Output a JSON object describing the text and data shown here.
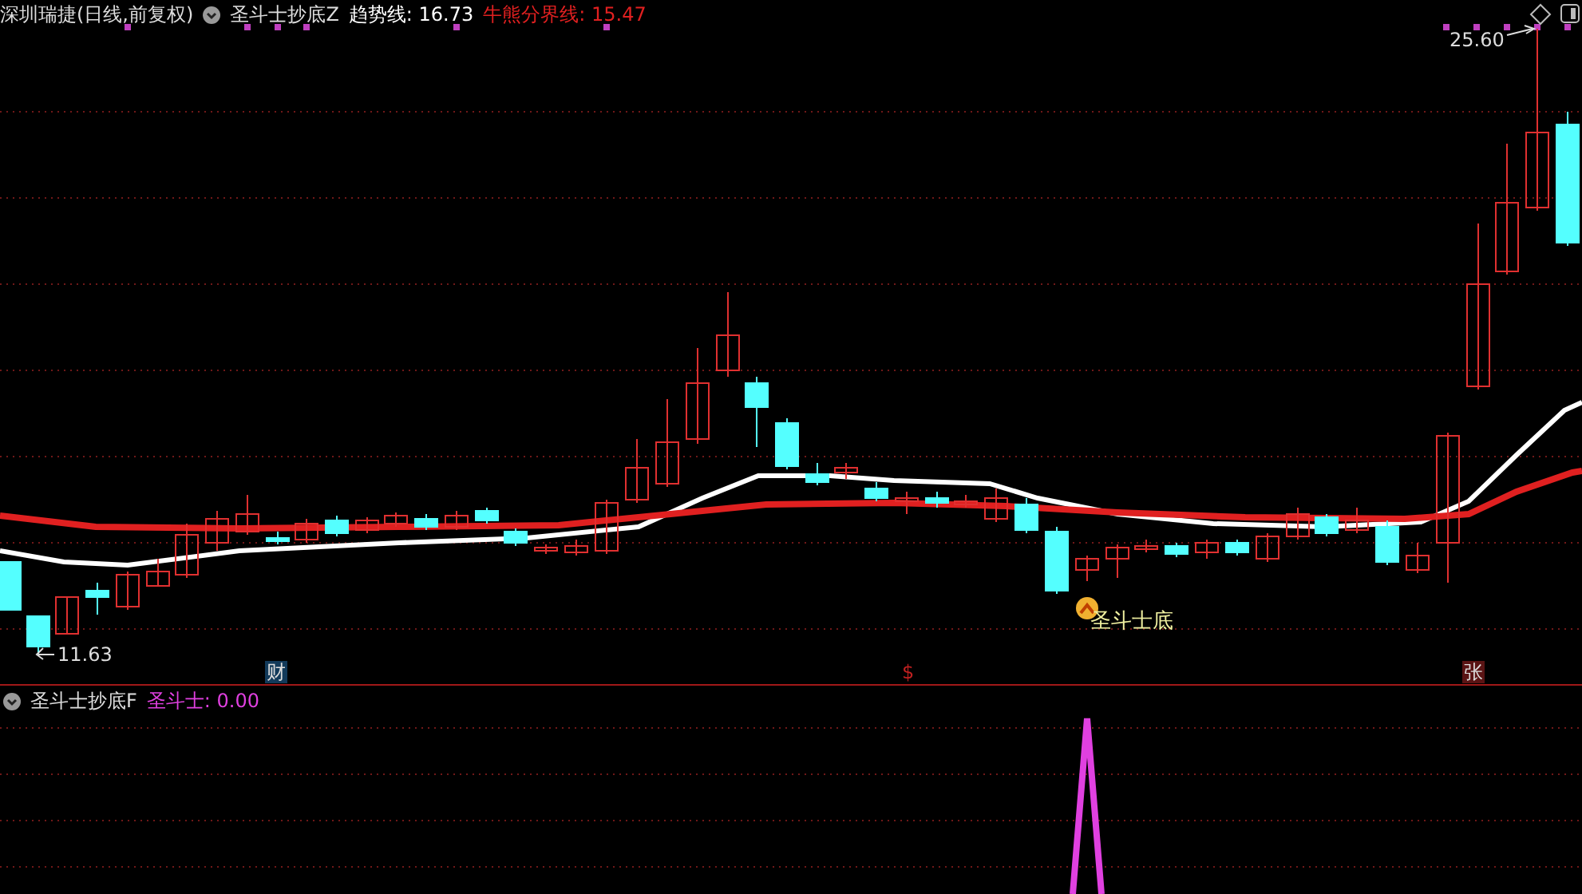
{
  "main_panel": {
    "title": "深圳瑞捷(日线,前复权)",
    "indicator": "圣斗士抄底Z",
    "lines": [
      {
        "label": "趋势线:",
        "value": "16.73",
        "color": "#ffffff"
      },
      {
        "label": "牛熊分界线:",
        "value": "15.47",
        "color": "#e02020"
      }
    ],
    "high_label": "25.60",
    "low_label": "11.63",
    "signal_label": "圣斗士底",
    "markers": [
      {
        "kind": "finance",
        "text": "财"
      },
      {
        "kind": "dividend",
        "text": "$"
      },
      {
        "kind": "rise",
        "text": "张"
      }
    ]
  },
  "sub_panel": {
    "indicator": "圣斗士抄底F",
    "lines": [
      {
        "label": "圣斗士:",
        "value": "0.00",
        "color": "#e040e0"
      }
    ]
  }
}
